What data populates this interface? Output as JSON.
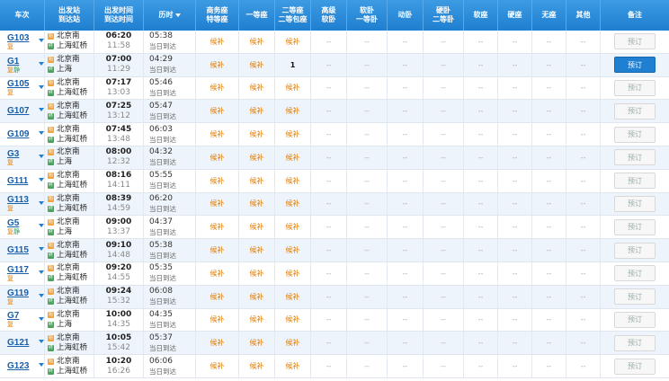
{
  "headers": {
    "train": "车次",
    "station_top": "出发站",
    "station_bottom": "到达站",
    "time_top": "出发时间",
    "time_bottom": "到达时间",
    "duration": "历时",
    "business_top": "商务座",
    "business_bottom": "特等座",
    "first": "一等座",
    "second_top": "二等座",
    "second_bottom": "二等包座",
    "hsoft_top": "高级",
    "hsoft_bottom": "软卧",
    "soft_top": "软卧",
    "soft_bottom": "一等卧",
    "moving": "动卧",
    "hard_top": "硬卧",
    "hard_bottom": "二等卧",
    "softseat": "软座",
    "hardseat": "硬座",
    "noseat": "无座",
    "other": "其他",
    "note": "备注"
  },
  "rows": [
    {
      "train": "G103",
      "badge": "复",
      "from": "北京南",
      "to": "上海虹桥",
      "dep": "06:20",
      "arr": "11:58",
      "dur": "05:38",
      "day": "当日到达",
      "biz": "候补",
      "first": "候补",
      "second": "候补",
      "book": "预订",
      "active": false
    },
    {
      "train": "G1",
      "badge": "复",
      "badge2": "静",
      "from": "北京南",
      "to": "上海",
      "dep": "07:00",
      "arr": "11:29",
      "dur": "04:29",
      "day": "当日到达",
      "biz": "候补",
      "first": "候补",
      "second": "1",
      "book": "预订",
      "active": true
    },
    {
      "train": "G105",
      "badge": "复",
      "from": "北京南",
      "to": "上海虹桥",
      "dep": "07:17",
      "arr": "13:03",
      "dur": "05:46",
      "day": "当日到达",
      "biz": "候补",
      "first": "候补",
      "second": "候补",
      "book": "预订",
      "active": false
    },
    {
      "train": "G107",
      "badge": "",
      "from": "北京南",
      "to": "上海虹桥",
      "dep": "07:25",
      "arr": "13:12",
      "dur": "05:47",
      "day": "当日到达",
      "biz": "候补",
      "first": "候补",
      "second": "候补",
      "book": "预订",
      "active": false
    },
    {
      "train": "G109",
      "badge": "",
      "from": "北京南",
      "to": "上海虹桥",
      "dep": "07:45",
      "arr": "13:48",
      "dur": "06:03",
      "day": "当日到达",
      "biz": "候补",
      "first": "候补",
      "second": "候补",
      "book": "预订",
      "active": false
    },
    {
      "train": "G3",
      "badge": "复",
      "from": "北京南",
      "to": "上海",
      "dep": "08:00",
      "arr": "12:32",
      "dur": "04:32",
      "day": "当日到达",
      "biz": "候补",
      "first": "候补",
      "second": "候补",
      "book": "预订",
      "active": false
    },
    {
      "train": "G111",
      "badge": "",
      "from": "北京南",
      "to": "上海虹桥",
      "dep": "08:16",
      "arr": "14:11",
      "dur": "05:55",
      "day": "当日到达",
      "biz": "候补",
      "first": "候补",
      "second": "候补",
      "book": "预订",
      "active": false
    },
    {
      "train": "G113",
      "badge": "复",
      "from": "北京南",
      "to": "上海虹桥",
      "dep": "08:39",
      "arr": "14:59",
      "dur": "06:20",
      "day": "当日到达",
      "biz": "候补",
      "first": "候补",
      "second": "候补",
      "book": "预订",
      "active": false
    },
    {
      "train": "G5",
      "badge": "复",
      "badge2": "静",
      "from": "北京南",
      "to": "上海",
      "dep": "09:00",
      "arr": "13:37",
      "dur": "04:37",
      "day": "当日到达",
      "biz": "候补",
      "first": "候补",
      "second": "候补",
      "book": "预订",
      "active": false
    },
    {
      "train": "G115",
      "badge": "",
      "from": "北京南",
      "to": "上海虹桥",
      "dep": "09:10",
      "arr": "14:48",
      "dur": "05:38",
      "day": "当日到达",
      "biz": "候补",
      "first": "候补",
      "second": "候补",
      "book": "预订",
      "active": false
    },
    {
      "train": "G117",
      "badge": "复",
      "from": "北京南",
      "to": "上海虹桥",
      "dep": "09:20",
      "arr": "14:55",
      "dur": "05:35",
      "day": "当日到达",
      "biz": "候补",
      "first": "候补",
      "second": "候补",
      "book": "预订",
      "active": false
    },
    {
      "train": "G119",
      "badge": "复",
      "from": "北京南",
      "to": "上海虹桥",
      "dep": "09:24",
      "arr": "15:32",
      "dur": "06:08",
      "day": "当日到达",
      "biz": "候补",
      "first": "候补",
      "second": "候补",
      "book": "预订",
      "active": false
    },
    {
      "train": "G7",
      "badge": "复",
      "from": "北京南",
      "to": "上海",
      "dep": "10:00",
      "arr": "14:35",
      "dur": "04:35",
      "day": "当日到达",
      "biz": "候补",
      "first": "候补",
      "second": "候补",
      "book": "预订",
      "active": false
    },
    {
      "train": "G121",
      "badge": "",
      "from": "北京南",
      "to": "上海虹桥",
      "dep": "10:05",
      "arr": "15:42",
      "dur": "05:37",
      "day": "当日到达",
      "biz": "候补",
      "first": "候补",
      "second": "候补",
      "book": "预订",
      "active": false
    },
    {
      "train": "G123",
      "badge": "",
      "from": "北京南",
      "to": "上海虹桥",
      "dep": "10:20",
      "arr": "16:26",
      "dur": "06:06",
      "day": "当日到达",
      "biz": "候补",
      "first": "候补",
      "second": "候补",
      "book": "预订",
      "active": false
    }
  ],
  "empty": "--",
  "colors": {
    "header": "#1f7fd0",
    "candidate": "#e07b00",
    "active_button": "#1f7fd0"
  }
}
